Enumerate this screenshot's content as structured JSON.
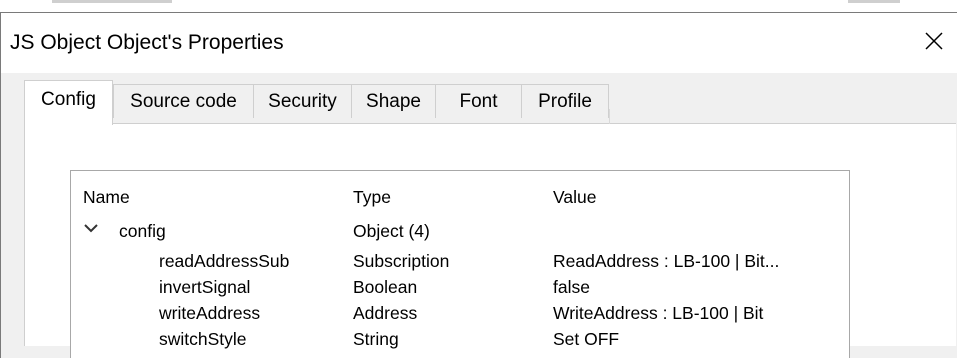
{
  "dialog": {
    "title": "JS Object Object's Properties"
  },
  "tabs": [
    {
      "label": "Config",
      "active": true
    },
    {
      "label": "Source code"
    },
    {
      "label": "Security"
    },
    {
      "label": "Shape"
    },
    {
      "label": "Font"
    },
    {
      "label": "Profile"
    }
  ],
  "tree": {
    "columns": [
      "Name",
      "Type",
      "Value"
    ],
    "root": {
      "name": "config",
      "type": "Object (4)",
      "value": "",
      "expanded": true
    },
    "children": [
      {
        "name": "readAddressSub",
        "type": "Subscription",
        "value": "ReadAddress : LB-100 | Bit..."
      },
      {
        "name": "invertSignal",
        "type": "Boolean",
        "value": "false"
      },
      {
        "name": "writeAddress",
        "type": "Address",
        "value": "WriteAddress : LB-100 | Bit"
      },
      {
        "name": "switchStyle",
        "type": "String",
        "value": "Set OFF"
      }
    ]
  },
  "icons": {
    "close": "close-icon",
    "expand": "chevron-down-icon"
  },
  "colors": {
    "titlebar_bg": "#ffffff",
    "dialog_bg": "#f0f0f0",
    "panel_bg": "#ffffff",
    "border": "#a8a8a8"
  }
}
